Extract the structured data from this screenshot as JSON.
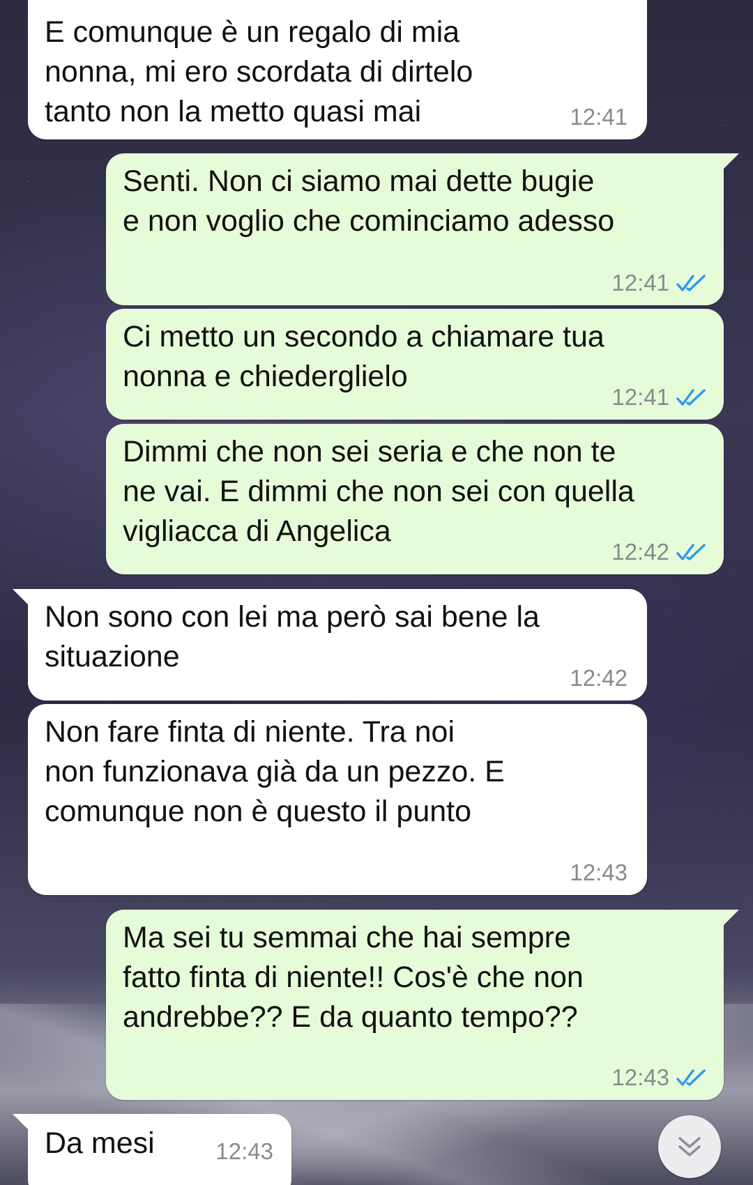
{
  "messages": [
    {
      "direction": "incoming",
      "text": "E comunque è un regalo di mia\nnonna, mi ero scordata di dirtelo\ntanto non la metto quasi mai",
      "time": "12:41"
    },
    {
      "direction": "outgoing",
      "text": "Senti. Non ci siamo mai dette bugie\ne non voglio che cominciamo adesso",
      "time": "12:41",
      "status": "read"
    },
    {
      "direction": "outgoing",
      "text": "Ci metto un secondo a chiamare tua\nnonna e chiederglielo",
      "time": "12:41",
      "status": "read"
    },
    {
      "direction": "outgoing",
      "text": "Dimmi che non sei seria e che non te\nne vai. E dimmi che non sei con quella\nvigliacca di Angelica",
      "time": "12:42",
      "status": "read"
    },
    {
      "direction": "incoming",
      "text": "Non sono con lei ma però sai bene la\nsituazione",
      "time": "12:42"
    },
    {
      "direction": "incoming",
      "text": "Non fare finta di niente. Tra noi\nnon funzionava già da un pezzo. E\ncomunque non è questo il punto",
      "time": "12:43"
    },
    {
      "direction": "outgoing",
      "text": "Ma sei tu semmai che hai sempre\nfatto finta di niente!! Cos'è che non\nandrebbe?? E da quanto tempo??",
      "time": "12:43",
      "status": "read"
    },
    {
      "direction": "incoming",
      "text": "Da mesi",
      "time": "12:43"
    }
  ],
  "colors": {
    "incoming_bubble": "#ffffff",
    "outgoing_bubble": "#e6fcd9",
    "read_ticks": "#2f9be8",
    "timestamp": "#8a8a8a"
  },
  "icons": {
    "read_receipt": "double-check-icon",
    "scroll_down": "double-chevron-down-icon"
  }
}
